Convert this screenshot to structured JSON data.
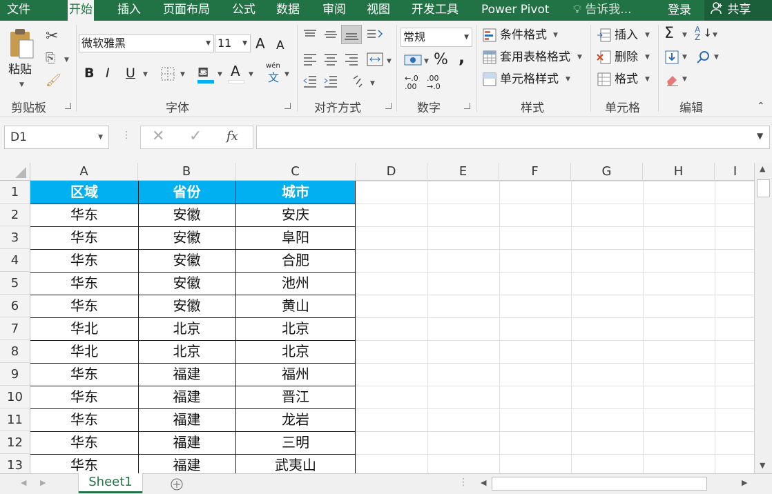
{
  "tabs": [
    {
      "label": "文件",
      "active": false
    },
    {
      "label": "开始",
      "active": true
    },
    {
      "label": "插入",
      "active": false
    },
    {
      "label": "页面布局",
      "active": false
    },
    {
      "label": "公式",
      "active": false
    },
    {
      "label": "数据",
      "active": false
    },
    {
      "label": "审阅",
      "active": false
    },
    {
      "label": "视图",
      "active": false
    },
    {
      "label": "开发工具",
      "active": false
    },
    {
      "label": "Power Pivot",
      "active": false
    }
  ],
  "tell_me": "告诉我...",
  "login": "登录",
  "share": "共享",
  "ribbon": {
    "clipboard": {
      "paste": "粘贴",
      "label": "剪贴板"
    },
    "font": {
      "name": "微软雅黑",
      "size": "11",
      "label": "字体",
      "bold": "B",
      "italic": "I",
      "underline": "U",
      "grow": "A",
      "shrink": "A",
      "wen_top": "wén",
      "wen_bottom": "文"
    },
    "alignment": {
      "label": "对齐方式"
    },
    "number": {
      "format": "常规",
      "label": "数字",
      "percent": "%",
      "comma": ",",
      "inc_decimal": "←.0 .00",
      "dec_decimal": ".00 →.0"
    },
    "styles": {
      "conditional": "条件格式",
      "table": "套用表格格式",
      "cell": "单元格样式",
      "label": "样式"
    },
    "cells": {
      "insert": "插入",
      "delete": "删除",
      "format": "格式",
      "label": "单元格"
    },
    "editing": {
      "label": "编辑",
      "sigma": "Σ",
      "sort": "A Z"
    }
  },
  "formula_bar": {
    "name_box": "D1",
    "formula": "",
    "fx": "fx"
  },
  "grid": {
    "columns": [
      "A",
      "B",
      "C",
      "D",
      "E",
      "F",
      "G",
      "H",
      "I"
    ],
    "rows": [
      "1",
      "2",
      "3",
      "4",
      "5",
      "6",
      "7",
      "8",
      "9",
      "10",
      "11",
      "12",
      "13"
    ],
    "headers": [
      "区域",
      "省份",
      "城市"
    ],
    "data": [
      [
        "华东",
        "安徽",
        "安庆"
      ],
      [
        "华东",
        "安徽",
        "阜阳"
      ],
      [
        "华东",
        "安徽",
        "合肥"
      ],
      [
        "华东",
        "安徽",
        "池州"
      ],
      [
        "华东",
        "安徽",
        "黄山"
      ],
      [
        "华北",
        "北京",
        "北京"
      ],
      [
        "华北",
        "北京",
        "北京"
      ],
      [
        "华东",
        "福建",
        "福州"
      ],
      [
        "华东",
        "福建",
        "晋江"
      ],
      [
        "华东",
        "福建",
        "龙岩"
      ],
      [
        "华东",
        "福建",
        "三明"
      ],
      [
        "华东",
        "福建",
        "武夷山"
      ]
    ]
  },
  "sheets": [
    {
      "name": "Sheet1",
      "active": true
    }
  ],
  "colors": {
    "brand": "#217346",
    "header_fill": "#00b0f0",
    "header_text": "#ffffff"
  }
}
